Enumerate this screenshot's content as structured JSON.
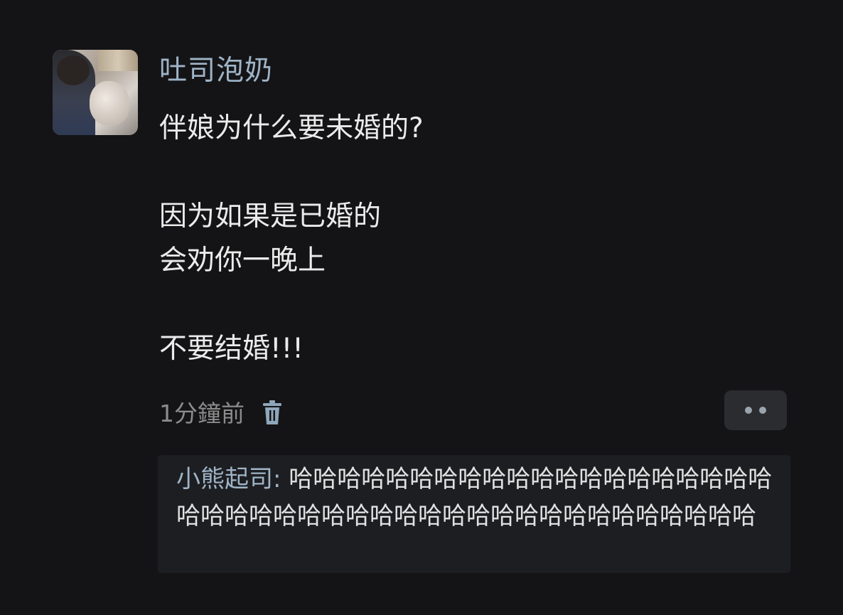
{
  "post": {
    "username": "吐司泡奶",
    "lines": [
      "伴娘为什么要未婚的?",
      "",
      "因为如果是已婚的",
      "会劝你一晚上",
      "",
      "不要结婚!!!"
    ],
    "time": "1分鐘前",
    "icons": {
      "avatar": "user-photo-avatar",
      "delete": "trash-icon",
      "more": "more-dots-icon"
    }
  },
  "reply": {
    "author": "小熊起司",
    "separator": ": ",
    "text": "哈哈哈哈哈哈哈哈哈哈哈哈哈哈哈哈哈哈哈哈哈哈哈哈哈哈哈哈哈哈哈哈哈哈哈哈哈哈哈哈哈哈哈哈"
  },
  "colors": {
    "background": "#141416",
    "username": "#9fb4c8",
    "text": "#ebebeb",
    "meta": "#8c8c8c",
    "reply_bg": "#1d1e21"
  }
}
